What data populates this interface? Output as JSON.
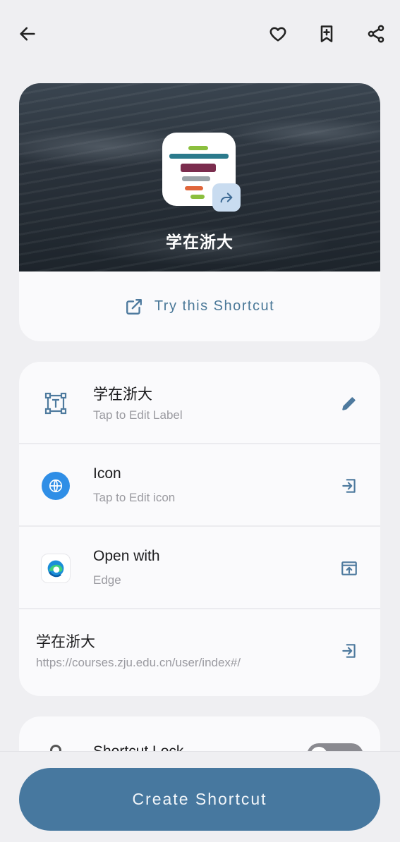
{
  "header": {
    "back_icon": "arrow-left-icon",
    "favorite_icon": "heart-icon",
    "bookmark_icon": "bookmark-add-icon",
    "share_icon": "share-icon"
  },
  "preview": {
    "title": "学在浙大",
    "try_label": "Try this Shortcut"
  },
  "settings": {
    "label": {
      "title": "学在浙大",
      "subtitle": "Tap to Edit Label"
    },
    "icon": {
      "title": "Icon",
      "subtitle": "Tap to Edit icon"
    },
    "open_with": {
      "title": "Open with",
      "subtitle": "Edge"
    },
    "link": {
      "title": "学在浙大",
      "subtitle": "https://courses.zju.edu.cn/user/index#/"
    }
  },
  "lock": {
    "title": "Shortcut Lock",
    "enabled": false
  },
  "actions": {
    "create_label": "Create Shortcut"
  },
  "colors": {
    "accent": "#47789f",
    "icon_accent": "#4e7a9e",
    "background": "#efeff2"
  }
}
